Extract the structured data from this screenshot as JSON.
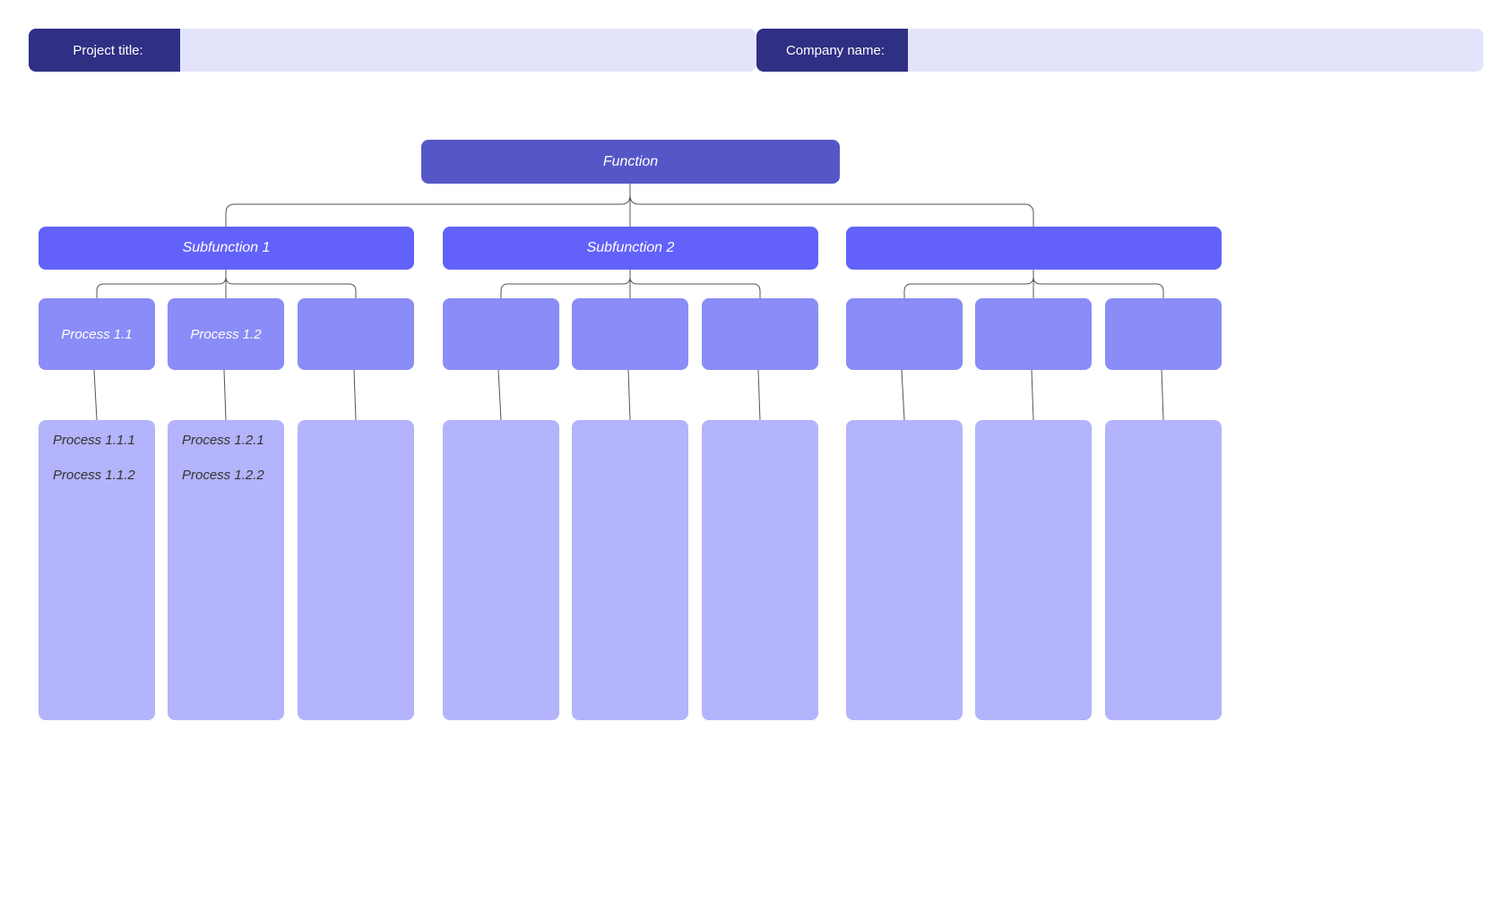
{
  "header": {
    "project_label": "Project title:",
    "company_label": "Company name:",
    "project_value": "",
    "company_value": ""
  },
  "diagram": {
    "root": {
      "label": "Function"
    },
    "subfunctions": [
      {
        "label": "Subfunction 1"
      },
      {
        "label": "Subfunction 2"
      },
      {
        "label": ""
      }
    ],
    "processes": [
      {
        "label": "Process 1.1"
      },
      {
        "label": "Process 1.2"
      },
      {
        "label": ""
      },
      {
        "label": ""
      },
      {
        "label": ""
      },
      {
        "label": ""
      },
      {
        "label": ""
      },
      {
        "label": ""
      },
      {
        "label": ""
      }
    ],
    "subprocesses": [
      {
        "items": [
          "Process 1.1.1",
          "Process 1.1.2"
        ]
      },
      {
        "items": [
          "Process 1.2.1",
          "Process 1.2.2"
        ]
      },
      {
        "items": []
      },
      {
        "items": []
      },
      {
        "items": []
      },
      {
        "items": []
      },
      {
        "items": []
      },
      {
        "items": []
      },
      {
        "items": []
      }
    ]
  }
}
